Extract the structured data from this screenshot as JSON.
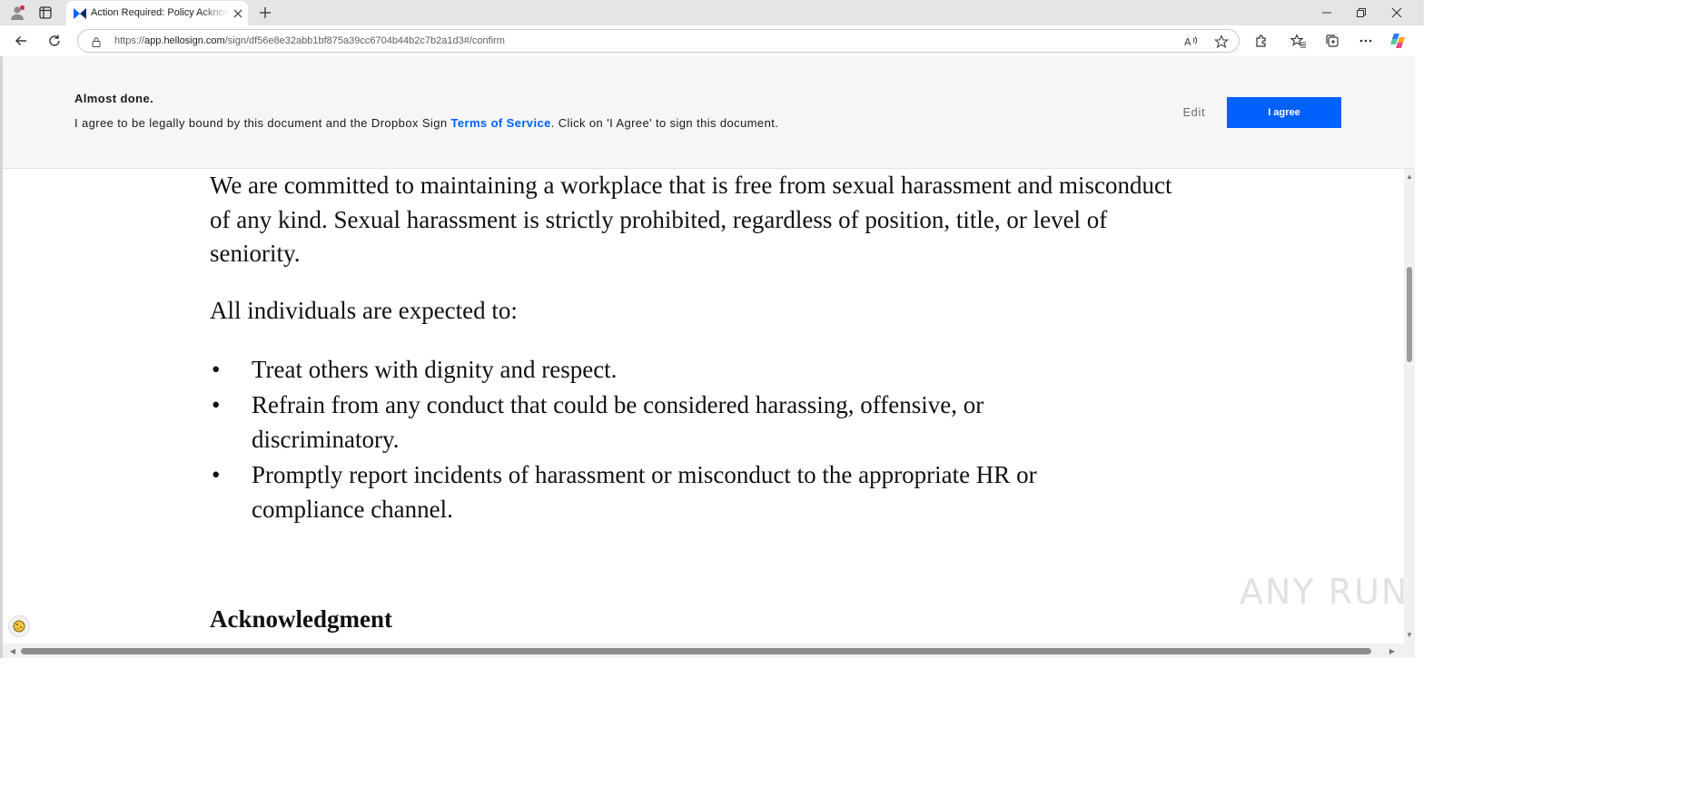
{
  "browser": {
    "tab_title": "Action Required: Policy Acknowledgment",
    "address": {
      "scheme": "https://",
      "host": "app.hellosign.com",
      "path": "/sign/df56e8e32abb1bf875a39cc6704b44b2c7b2a1d3#/confirm"
    },
    "icons": {
      "profile": "profile-icon",
      "workspaces": "workspaces-icon",
      "favicon": "dropbox-sign-logo",
      "close_tab": "close-icon",
      "new_tab": "plus-icon",
      "minimize": "minimize-icon",
      "restore": "restore-icon",
      "close_window": "close-icon",
      "back": "back-arrow-icon",
      "refresh": "refresh-icon",
      "lock": "lock-icon",
      "read_aloud": "read-aloud-icon",
      "favorite": "star-icon",
      "extensions": "puzzle-icon",
      "favorites": "favorites-icon",
      "collections": "collections-icon",
      "menu": "more-icon",
      "copilot": "copilot-icon"
    }
  },
  "signbar": {
    "heading": "Almost done.",
    "text_before": "I agree to be legally bound by this document and the Dropbox Sign ",
    "terms_link": "Terms of Service",
    "text_after": ". Click on 'I Agree' to sign this document.",
    "edit_label": "Edit",
    "agree_label": "I agree",
    "accent_color": "#0061fe"
  },
  "document": {
    "paragraph1": "We are committed to maintaining a workplace that is free from sexual harassment and misconduct of any kind. Sexual harassment is strictly prohibited, regardless of position, title, or level of seniority.",
    "paragraph2": "All individuals are expected to:",
    "bullets": [
      "Treat others with dignity and respect.",
      "Refrain from any conduct that could be considered harassing, offensive, or discriminatory.",
      "Promptly report incidents of harassment or misconduct to the appropriate HR or compliance channel."
    ],
    "bullet_symbol": "•",
    "heading": "Acknowledgment"
  },
  "overlay": {
    "watermark": "ANY RUN"
  }
}
